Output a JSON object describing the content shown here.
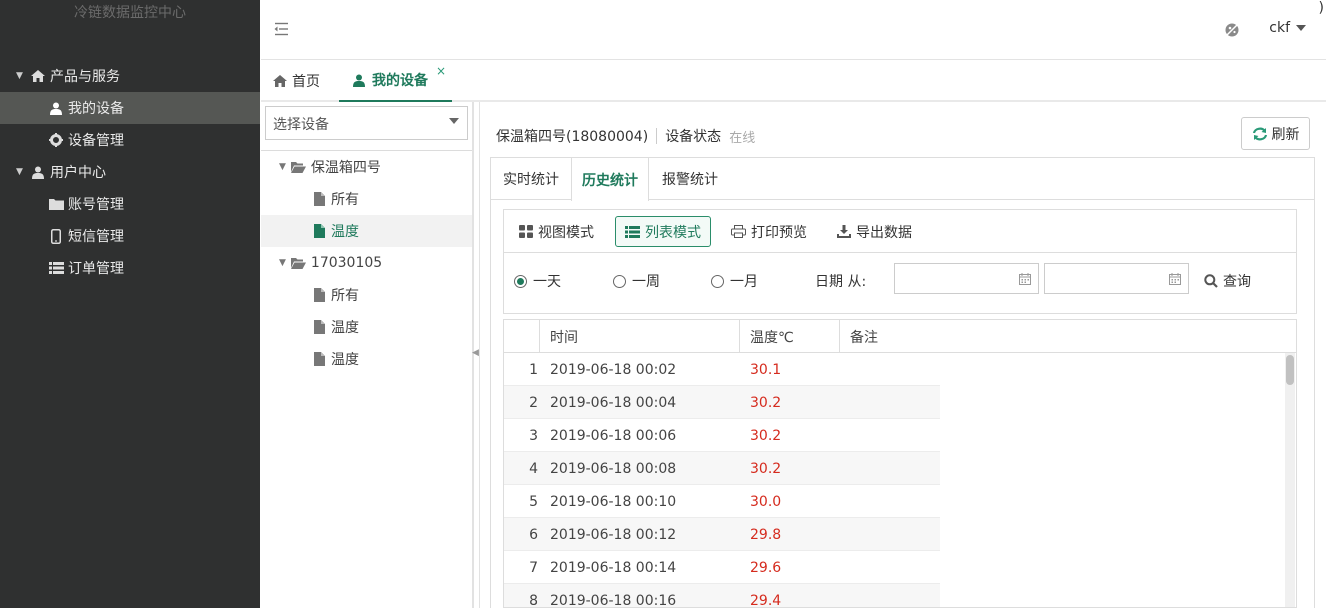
{
  "app": {
    "title": "冷链数据监控中心"
  },
  "sidebar": {
    "groups": [
      {
        "label": "产品与服务",
        "items": [
          {
            "label": "我的设备"
          },
          {
            "label": "设备管理"
          }
        ]
      },
      {
        "label": "用户中心",
        "items": [
          {
            "label": "账号管理"
          },
          {
            "label": "短信管理"
          },
          {
            "label": "订单管理"
          }
        ]
      }
    ]
  },
  "topbar": {
    "user": "ckf",
    "stray_char": ")"
  },
  "tabs": [
    {
      "label": "首页"
    },
    {
      "label": "我的设备",
      "close": "×"
    }
  ],
  "device_panel": {
    "select_placeholder": "选择设备",
    "tree": [
      {
        "label": "保温箱四号",
        "children": [
          {
            "label": "所有"
          },
          {
            "label": "温度"
          }
        ]
      },
      {
        "label": "17030105",
        "children": [
          {
            "label": "所有"
          },
          {
            "label": "温度"
          },
          {
            "label": "温度"
          }
        ]
      }
    ]
  },
  "device": {
    "name": "保温箱四号(18080004)",
    "status_label": "设备状态",
    "status_value": "在线",
    "refresh": "刷新"
  },
  "stat_tabs": [
    {
      "label": "实时统计"
    },
    {
      "label": "历史统计"
    },
    {
      "label": "报警统计"
    }
  ],
  "toolbar": {
    "view_mode": "视图模式",
    "list_mode": "列表模式",
    "print_preview": "打印预览",
    "export": "导出数据"
  },
  "filter": {
    "ranges": [
      {
        "label": "一天"
      },
      {
        "label": "一周"
      },
      {
        "label": "一月"
      }
    ],
    "date_label": "日期 从:",
    "query": "查询"
  },
  "table": {
    "headers": {
      "time": "时间",
      "temp": "温度℃",
      "note": "备注"
    },
    "rows": [
      {
        "no": "1",
        "time": "2019-06-18 00:02",
        "temp": "30.1"
      },
      {
        "no": "2",
        "time": "2019-06-18 00:04",
        "temp": "30.2"
      },
      {
        "no": "3",
        "time": "2019-06-18 00:06",
        "temp": "30.2"
      },
      {
        "no": "4",
        "time": "2019-06-18 00:08",
        "temp": "30.2"
      },
      {
        "no": "5",
        "time": "2019-06-18 00:10",
        "temp": "30.0"
      },
      {
        "no": "6",
        "time": "2019-06-18 00:12",
        "temp": "29.8"
      },
      {
        "no": "7",
        "time": "2019-06-18 00:14",
        "temp": "29.6"
      },
      {
        "no": "8",
        "time": "2019-06-18 00:16",
        "temp": "29.4"
      }
    ]
  },
  "colors": {
    "accent": "#1f7a5c",
    "sidebar_bg": "#2f3030",
    "temp_text": "#d52b1e"
  }
}
